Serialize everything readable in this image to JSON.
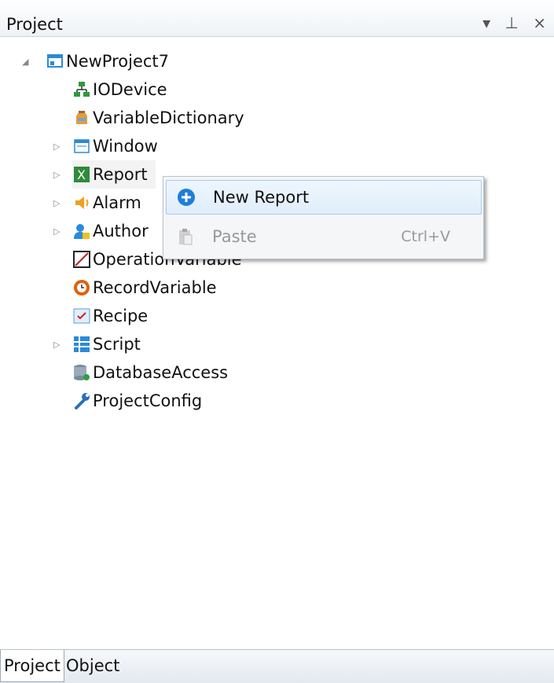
{
  "panel": {
    "title": "Project",
    "controls": "▾ ⊥ ×"
  },
  "tree": {
    "root": "NewProject7",
    "items": [
      {
        "label": "IODevice"
      },
      {
        "label": "VariableDictionary"
      },
      {
        "label": "Window"
      },
      {
        "label": "Report"
      },
      {
        "label": "Alarm"
      },
      {
        "label": "Author"
      },
      {
        "label": "OperationVariable"
      },
      {
        "label": "RecordVariable"
      },
      {
        "label": "Recipe"
      },
      {
        "label": "Script"
      },
      {
        "label": "DatabaseAccess"
      },
      {
        "label": "ProjectConfig"
      }
    ]
  },
  "context_menu": {
    "items": [
      {
        "label": "New Report",
        "shortcut": ""
      },
      {
        "label": "Paste",
        "shortcut": "Ctrl+V"
      }
    ]
  },
  "tabs": [
    {
      "label": "Project"
    },
    {
      "label": "Object"
    }
  ],
  "icons": {
    "root": "project-icon",
    "iodevice": "network-icon",
    "vardict": "jar-icon",
    "window": "window-icon",
    "report": "excel-icon",
    "alarm": "speaker-icon",
    "author": "user-lock-icon",
    "opvar": "chart-line-icon",
    "recvar": "clock-icon",
    "recipe": "checklist-icon",
    "script": "grid-icon",
    "db": "database-icon",
    "config": "wrench-icon"
  }
}
